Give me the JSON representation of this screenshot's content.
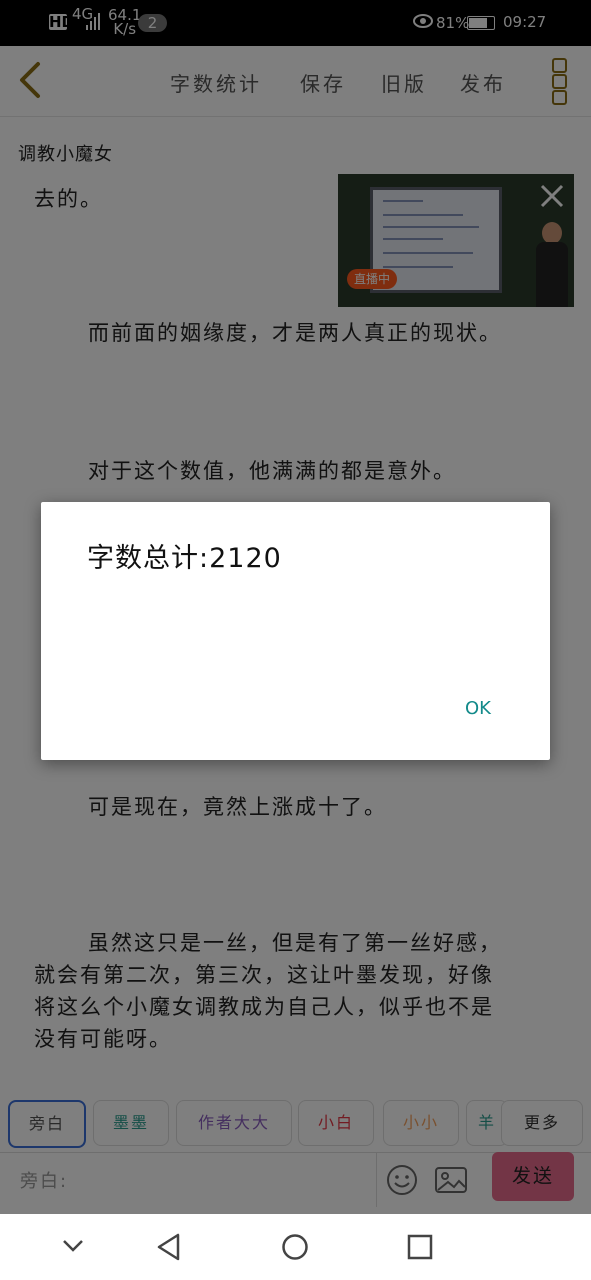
{
  "status_bar": {
    "hd_label": "HD",
    "network": "4G",
    "speed_value": "64.1",
    "speed_unit": "K/s",
    "notification_count": "2",
    "battery_percent": "81%",
    "battery_level": 0.81,
    "time": "09:27"
  },
  "toolbar": {
    "word_count_label": "字数统计",
    "save_label": "保存",
    "old_version_label": "旧版",
    "publish_label": "发布"
  },
  "document": {
    "title": "调教小魔女",
    "paragraphs": [
      "去的。",
      "而前面的姻缘度，才是两人真正的现状。",
      "对于这个数值，他满满的都是意外。",
      "可是现在，竟然上涨成十了。",
      "虽然这只是一丝，但是有了第一丝好感，",
      "就会有第二次，第三次，这让叶墨发现，好像",
      "将这么个小魔女调教成为自己人，似乎也不是",
      "没有可能呀。"
    ]
  },
  "live_video": {
    "badge": "直播中"
  },
  "role_tags": [
    {
      "label": "旁白",
      "color": "#555555"
    },
    {
      "label": "墨墨",
      "color": "#2a9d8f"
    },
    {
      "label": "作者大大",
      "color": "#8a5fbf"
    },
    {
      "label": "小白",
      "color": "#e63946"
    },
    {
      "label": "小小",
      "color": "#f4a261"
    },
    {
      "label": "羊",
      "color": "#2a9d8f"
    }
  ],
  "more_label": "更多",
  "composer": {
    "placeholder": "旁白:",
    "send_label": "发送"
  },
  "dialog": {
    "message": "字数总计:2120",
    "ok_label": "OK"
  }
}
